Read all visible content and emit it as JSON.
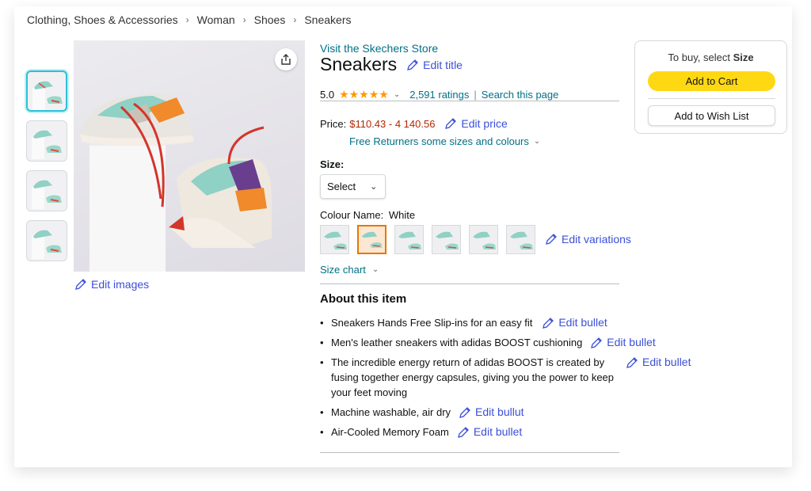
{
  "breadcrumb": [
    "Clothing, Shoes & Accessories",
    "Woman",
    "Shoes",
    "Sneakers"
  ],
  "store_link": "Visit the Skechers Store",
  "title": "Sneakers",
  "edit_title": "Edit title",
  "rating": {
    "value": "5.0",
    "stars": 5,
    "count_text": "2,591 ratings",
    "search_link": "Search this page"
  },
  "price": {
    "label": "Price:",
    "value": "$110.43 - 4 140.56",
    "edit_label": "Edit price"
  },
  "returns_text": "Free Returners some sizes and colours",
  "size": {
    "label": "Size:",
    "selected": "Select"
  },
  "colour": {
    "label": "Colour Name:",
    "value": "White",
    "edit_label": "Edit variations",
    "selected_index": 1
  },
  "size_chart": "Size chart",
  "edit_images": "Edit images",
  "about": {
    "title": "About this item",
    "bullets": [
      {
        "text": "Sneakers Hands Free Slip-ins for an easy fit",
        "edit": "Edit bullet"
      },
      {
        "text": "Men's leather sneakers with adidas BOOST cushioning",
        "edit": "Edit bullet"
      },
      {
        "text": "The incredible energy return of adidas BOOST is created by fusing together energy capsules, giving you the power to keep your feet moving",
        "edit": "Edit bullet"
      },
      {
        "text": "Machine washable, air dry",
        "edit": "Edit bullut"
      },
      {
        "text": "Air-Cooled Memory Foam",
        "edit": "Edit bullet"
      }
    ]
  },
  "buybox": {
    "hint_prefix": "To buy, select ",
    "hint_bold": "Size",
    "add_to_cart": "Add to Cart",
    "wish_list": "Add to Wish List"
  },
  "colors": {
    "accent_edit": "#3b4fd8",
    "link": "#007185",
    "price": "#b12704",
    "cart_button": "#ffd814",
    "selected_swatch": "#e77600",
    "selected_thumb": "#2ec0d6"
  }
}
